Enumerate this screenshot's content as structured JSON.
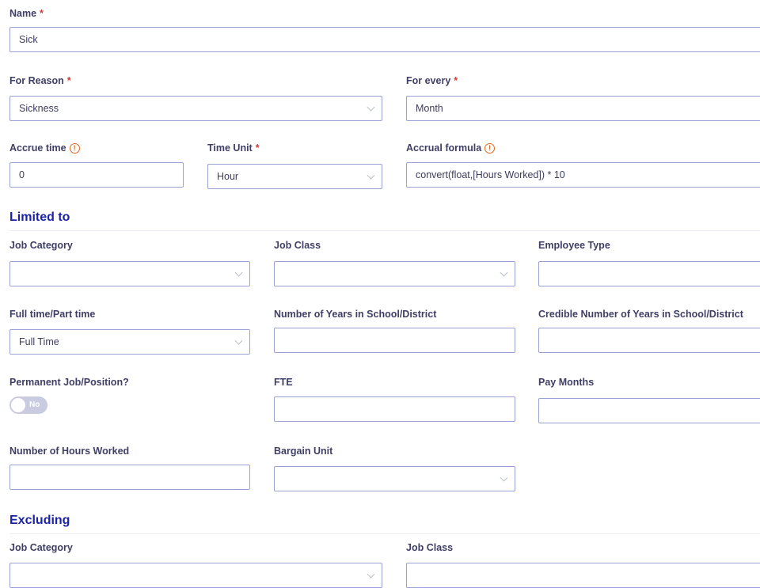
{
  "required_mark": "*",
  "name": {
    "label": "Name",
    "value": "Sick"
  },
  "for_reason": {
    "label": "For Reason",
    "value": "Sickness"
  },
  "for_every": {
    "label": "For every",
    "value": "Month"
  },
  "accrue_time": {
    "label": "Accrue time",
    "value": "0",
    "info_icon": "info-icon"
  },
  "time_unit": {
    "label": "Time Unit",
    "value": "Hour"
  },
  "accrual_formula": {
    "label": "Accrual formula",
    "value": "convert(float,[Hours Worked]) * 10",
    "info_icon": "info-icon"
  },
  "limited_to": {
    "title": "Limited to",
    "job_category": {
      "label": "Job Category",
      "value": ""
    },
    "job_class": {
      "label": "Job Class",
      "value": ""
    },
    "employee_type": {
      "label": "Employee Type",
      "value": ""
    },
    "full_part_time": {
      "label": "Full time/Part time",
      "value": "Full Time"
    },
    "years_school": {
      "label": "Number of Years in School/District",
      "value": ""
    },
    "credible_years": {
      "label": "Credible Number of Years in School/District",
      "value": ""
    },
    "permanent": {
      "label": "Permanent Job/Position?",
      "toggle_text": "No",
      "on": false
    },
    "fte": {
      "label": "FTE",
      "value": ""
    },
    "pay_months": {
      "label": "Pay Months",
      "value": ""
    },
    "hours_worked": {
      "label": "Number of Hours Worked",
      "value": ""
    },
    "bargain_unit": {
      "label": "Bargain Unit",
      "value": ""
    }
  },
  "excluding": {
    "title": "Excluding",
    "job_category": {
      "label": "Job Category",
      "value": ""
    },
    "job_class": {
      "label": "Job Class",
      "value": ""
    }
  },
  "colors": {
    "section_title": "#1a23a8",
    "border": "#9aa2d6",
    "required": "#d03a3a",
    "info": "#e0661a"
  }
}
